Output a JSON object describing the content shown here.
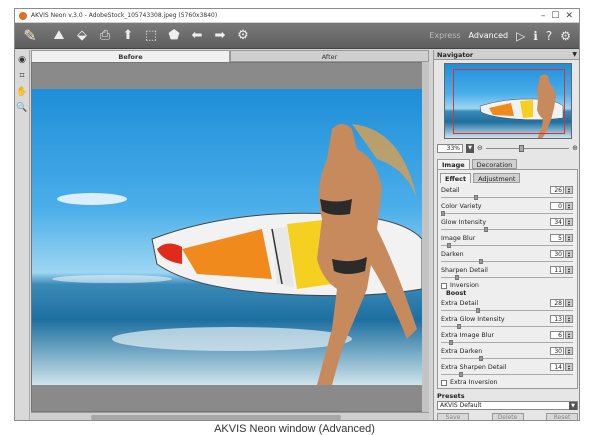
{
  "window": {
    "title": "AKVIS Neon v.3.0 - AdobeStock_105743308.jpeg (5760x3840)"
  },
  "toolbar": {
    "express_label": "Express",
    "advanced_label": "Advanced",
    "mode": "Advanced"
  },
  "view_tabs": {
    "before_label": "Before",
    "after_label": "After",
    "active": "Before"
  },
  "navigator": {
    "title": "Navigator",
    "zoom": "33%"
  },
  "panel_tabs": {
    "image_label": "Image",
    "decoration_label": "Decoration",
    "effect_label": "Effect",
    "adjustment_label": "Adjustment"
  },
  "params": [
    {
      "label": "Detail",
      "value": "26",
      "level": 0.26
    },
    {
      "label": "Color Variety",
      "value": "0",
      "level": 0.0
    },
    {
      "label": "Glow Intensity",
      "value": "34",
      "level": 0.34
    },
    {
      "label": "Image Blur",
      "value": "5",
      "level": 0.05
    },
    {
      "label": "Darken",
      "value": "30",
      "level": 0.3
    },
    {
      "label": "Sharpen Detail",
      "value": "11",
      "level": 0.11
    }
  ],
  "inversion_label": "Inversion",
  "boost_label": "Boost",
  "boost_params": [
    {
      "label": "Extra Detail",
      "value": "28",
      "level": 0.28
    },
    {
      "label": "Extra Glow Intensity",
      "value": "13",
      "level": 0.13
    },
    {
      "label": "Extra Image Blur",
      "value": "6",
      "level": 0.06
    },
    {
      "label": "Extra Darken",
      "value": "30",
      "level": 0.3
    },
    {
      "label": "Extra Sharpen Detail",
      "value": "14",
      "level": 0.14
    }
  ],
  "extra_inversion_label": "Extra Inversion",
  "presets": {
    "title": "Presets",
    "selected": "AKVIS Default",
    "save_label": "Save",
    "delete_label": "Delete",
    "reset_label": "Reset"
  },
  "caption": "AKVIS Neon window (Advanced)"
}
